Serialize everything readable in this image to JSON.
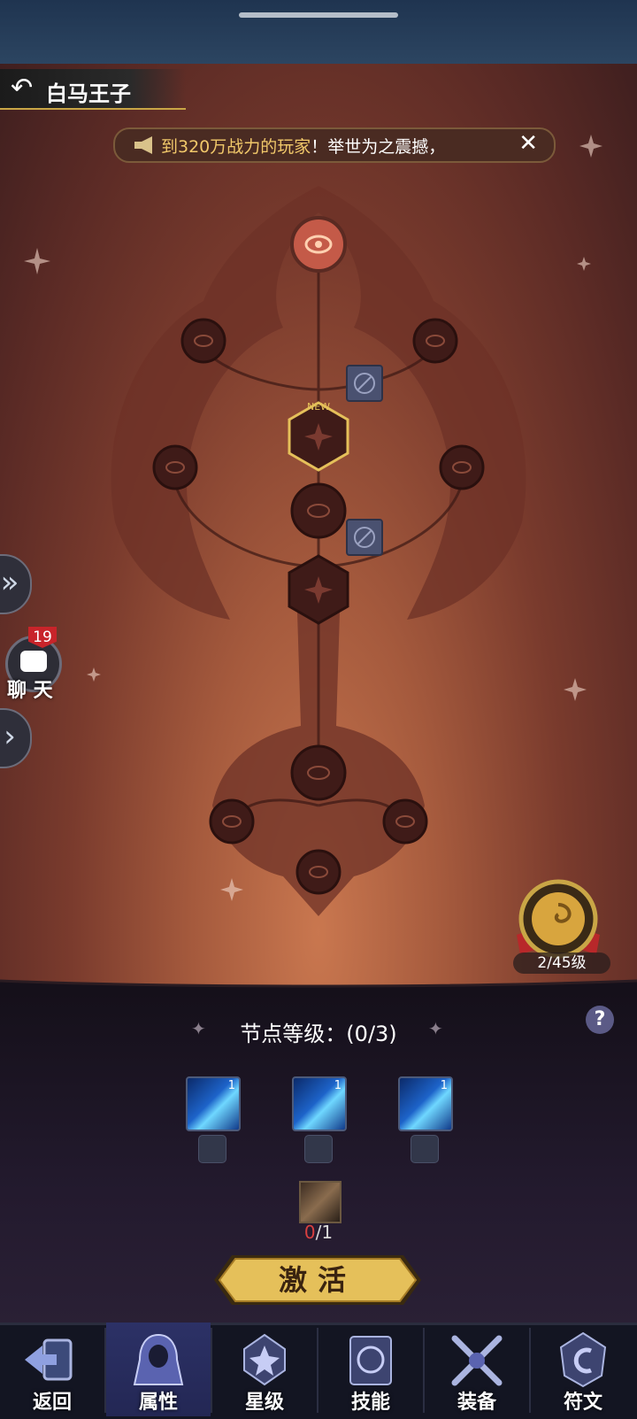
{
  "hero": {
    "name": "白马王子"
  },
  "ticker": {
    "highlight": "到320万战力的玩家",
    "text": "！举世为之震撼，"
  },
  "side": {
    "expand_icon": "double-chevron-right-icon",
    "chat_label": "聊 天",
    "chat_badge": "19",
    "collapse_icon": "chevron-right-icon"
  },
  "medal": {
    "level": "2/45级"
  },
  "tree": {
    "new_tag": "NEW"
  },
  "panel": {
    "node_level": "节点等级：(0/3)",
    "skills": [
      {
        "level": "1"
      },
      {
        "level": "1"
      },
      {
        "level": "1"
      }
    ],
    "material": {
      "have": "0",
      "need": "/1"
    },
    "activate_label": "激活"
  },
  "nav": {
    "tabs": [
      {
        "label": "返回"
      },
      {
        "label": "属性"
      },
      {
        "label": "星级"
      },
      {
        "label": "技能"
      },
      {
        "label": "装备"
      },
      {
        "label": "符文"
      }
    ]
  },
  "colors": {
    "accent_gold": "#e5c05a",
    "nav_active": "#2c3166",
    "badge_red": "#c8242a"
  }
}
